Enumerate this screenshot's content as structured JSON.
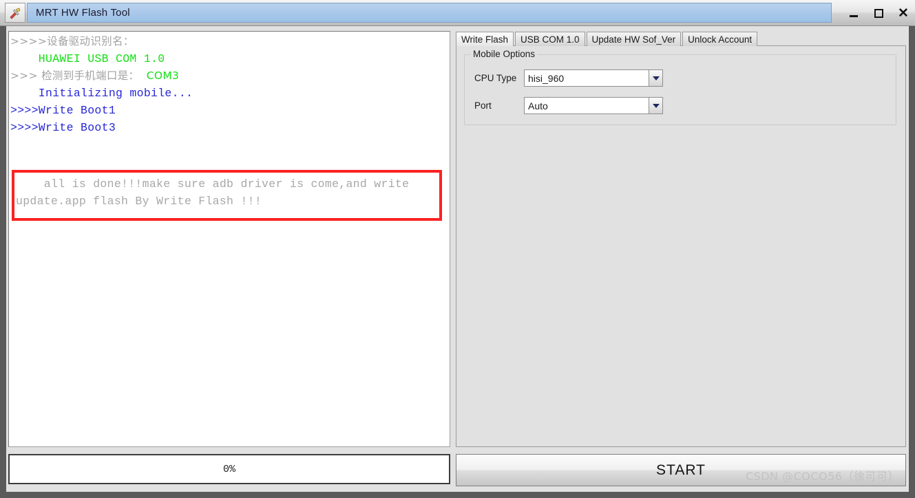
{
  "window": {
    "title": "MRT HW Flash Tool",
    "icon": "tools-icon",
    "controls": {
      "minimize": "minimize-icon",
      "maximize": "maximize-icon",
      "close": "close-icon"
    }
  },
  "log": {
    "lines": [
      {
        "text": ">>>>设备驱动识别名：",
        "color": "gray",
        "cjk": true
      },
      {
        "text": "    HUAWEI USB COM 1.0",
        "color": "green",
        "cjk": false
      },
      {
        "text": ">>> 检测到手机端口是：  COM3",
        "color": "gray",
        "cjk": true
      },
      {
        "text": "    Initializing mobile...",
        "color": "blue",
        "cjk": false
      },
      {
        "text": ">>>>Write Boot1",
        "color": "blue",
        "cjk": false
      },
      {
        "text": ">>>>Write Boot3",
        "color": "blue",
        "cjk": false
      }
    ],
    "highlighted": {
      "line1": "    all is done!!!make sure adb driver is come,and write",
      "line2": "update.app flash By Write Flash !!!",
      "border_color": "#fb2222"
    },
    "inline_green": {
      "com_port": "COM3"
    }
  },
  "progress": {
    "value_label": "0%",
    "percent": 0
  },
  "tabs": [
    {
      "label": "Write Flash",
      "active": true
    },
    {
      "label": "USB COM 1.0",
      "active": false
    },
    {
      "label": "Update HW Sof_Ver",
      "active": false
    },
    {
      "label": "Unlock Account",
      "active": false
    }
  ],
  "mobile_options": {
    "group_title": "Mobile Options",
    "cpu_type": {
      "label": "CPU Type",
      "value": "hisi_960"
    },
    "port": {
      "label": "Port",
      "value": "Auto"
    }
  },
  "actions": {
    "start_label": "START"
  },
  "watermark": {
    "text": "CSDN @COCO56（徐可可）"
  },
  "colors": {
    "green_text": "#14e014",
    "blue_text": "#2727d6",
    "gray_text": "#a3a3a3",
    "highlight_red": "#fb2222",
    "titlebar_blue": "#a9c8ea"
  }
}
